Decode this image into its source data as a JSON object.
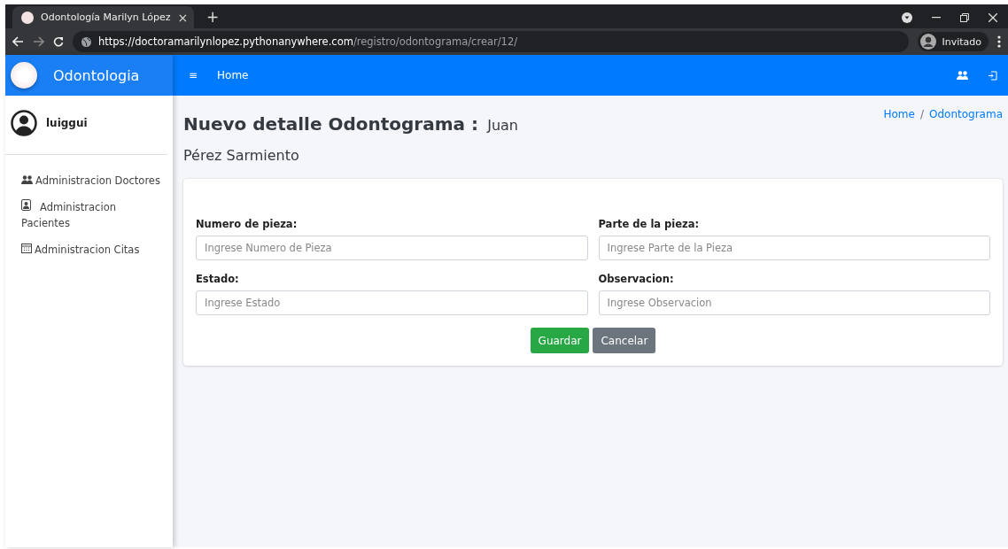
{
  "browser": {
    "tab_title": "Odontología Marilyn López",
    "tab_close": "×",
    "new_tab": "+",
    "url_host": "https://doctoramarilynlopez.pythonanywhere.com",
    "url_path": "/registro/odontograma/crear/12/",
    "profile": "Invitado"
  },
  "sidebar": {
    "brand": "Odontologia",
    "user": "luiggui",
    "items": [
      {
        "label": "Administracion Doctores",
        "kind": "doctors"
      },
      {
        "label": "Administracion Pacientes",
        "kind": "patients"
      },
      {
        "label": "Administracion Citas",
        "kind": "calendar"
      }
    ]
  },
  "navbar": {
    "menu_glyph": "≡",
    "home": "Home"
  },
  "page": {
    "title": "Nuevo detalle Odontograma :",
    "patient": "Juan Pérez Sarmiento",
    "breadcrumb": [
      {
        "label": "Home"
      },
      {
        "label": "Odontograma"
      }
    ],
    "separator": "/"
  },
  "form": {
    "fields": [
      {
        "label": "Numero de pieza:",
        "placeholder": "Ingrese Numero de Pieza"
      },
      {
        "label": "Parte de la pieza:",
        "placeholder": "Ingrese Parte de la Pieza"
      },
      {
        "label": "Estado:",
        "placeholder": "Ingrese Estado"
      },
      {
        "label": "Observacion:",
        "placeholder": "Ingrese Observacion"
      }
    ],
    "buttons": [
      {
        "label": "Guardar",
        "kind": "primary"
      },
      {
        "label": "Cancelar",
        "kind": "secondary"
      }
    ]
  }
}
